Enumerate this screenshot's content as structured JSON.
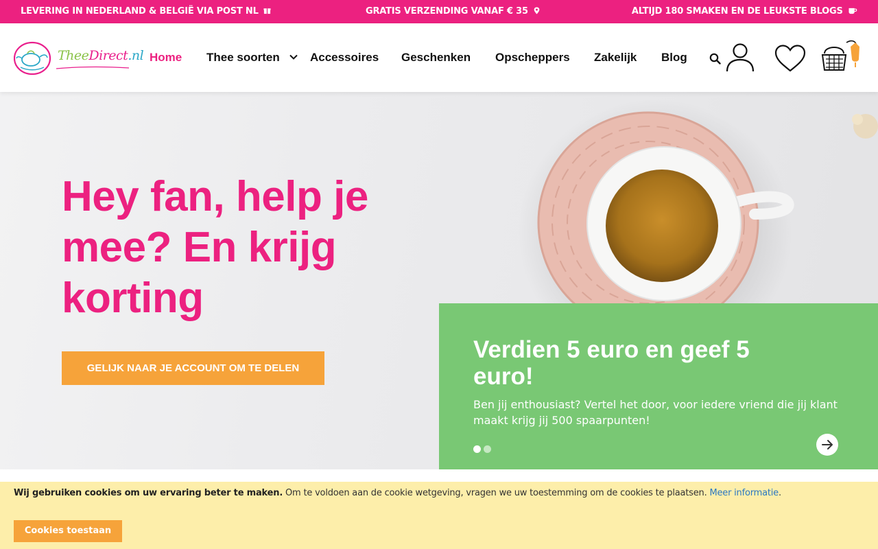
{
  "topbar": {
    "msg1": "LEVERING IN NEDERLAND & BELGIË VIA POST NL",
    "msg2": "GRATIS VERZENDING VANAF € 35",
    "msg3": "ALTIJD 180 SMAKEN EN DE LEUKSTE BLOGS"
  },
  "logo": {
    "part1": "Thee",
    "part2": "Direct",
    "part3": ".nl"
  },
  "nav": {
    "home": "Home",
    "thee_soorten": "Thee soorten",
    "accessoires": "Accessoires",
    "geschenken": "Geschenken",
    "opscheppers": "Opscheppers",
    "zakelijk": "Zakelijk",
    "blog": "Blog"
  },
  "hero": {
    "title": "Hey fan, help je mee? En krijg korting",
    "button": "GELIJK NAAR JE ACCOUNT OM TE DELEN"
  },
  "card": {
    "title": "Verdien 5 euro en geef 5 euro!",
    "text": "Ben jij enthousiast? Vertel het door, voor iedere vriend die jij klant maakt krijg jij 500 spaarpunten!"
  },
  "slider": {
    "active_slide": 1,
    "total_slides": 2
  },
  "cookie": {
    "bold": "Wij gebruiken cookies om uw ervaring beter te maken.",
    "text": " Om te voldoen aan de cookie wetgeving, vragen we uw toestemming om de cookies te plaatsen. ",
    "link": "Meer informatie",
    "button": "Cookies toestaan"
  },
  "colors": {
    "brand_pink": "#ec2180",
    "cta_orange": "#f6a33a",
    "card_green": "#79c874",
    "cookie_yellow": "#fdeeaa"
  },
  "icons": [
    "gift-icon",
    "map-pin-icon",
    "cup-icon",
    "chevron-down-icon",
    "search-icon",
    "user-icon",
    "heart-icon",
    "basket-icon",
    "arrow-right-icon"
  ]
}
